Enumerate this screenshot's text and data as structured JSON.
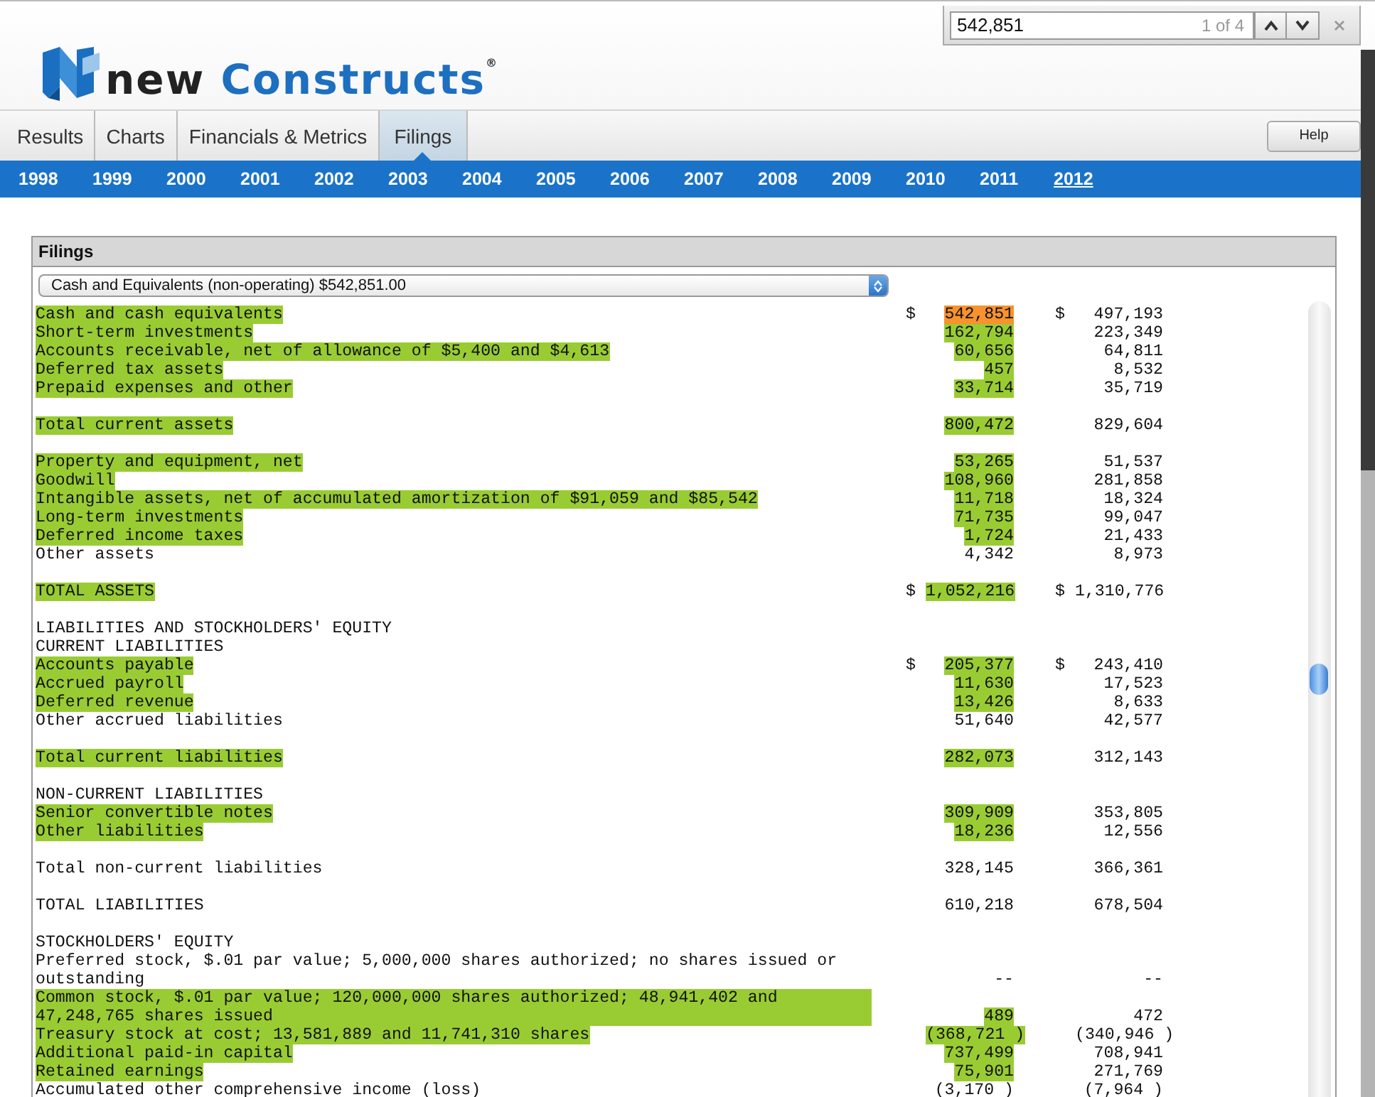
{
  "find_bar": {
    "query": "542,851",
    "count": "1 of 4"
  },
  "logo": {
    "word_1": "new",
    "word_2": "Constructs",
    "mark": "®"
  },
  "tabs": [
    {
      "label": "Results",
      "selected": false
    },
    {
      "label": "Charts",
      "selected": false
    },
    {
      "label": "Financials & Metrics",
      "selected": false
    },
    {
      "label": "Filings",
      "selected": true
    }
  ],
  "help_button": "Help",
  "years": [
    {
      "label": "1998",
      "selected": false
    },
    {
      "label": "1999",
      "selected": false
    },
    {
      "label": "2000",
      "selected": false
    },
    {
      "label": "2001",
      "selected": false
    },
    {
      "label": "2002",
      "selected": false
    },
    {
      "label": "2003",
      "selected": false
    },
    {
      "label": "2004",
      "selected": false
    },
    {
      "label": "2005",
      "selected": false
    },
    {
      "label": "2006",
      "selected": false
    },
    {
      "label": "2007",
      "selected": false
    },
    {
      "label": "2008",
      "selected": false
    },
    {
      "label": "2009",
      "selected": false
    },
    {
      "label": "2010",
      "selected": false
    },
    {
      "label": "2011",
      "selected": false
    },
    {
      "label": "2012",
      "selected": true
    }
  ],
  "panel": {
    "title": "Filings",
    "select_value": "Cash and Equivalents (non-operating) $542,851.00",
    "blocks": [
      {
        "rows": [
          {
            "label": "Cash and cash equivalents",
            "highlighted": true,
            "values": [
              {
                "currency": "$",
                "text": "542,851",
                "matched": true,
                "current": true
              },
              {
                "currency": "$",
                "text": "497,193",
                "matched": false,
                "current": false
              }
            ]
          },
          {
            "label": "Short-term investments",
            "highlighted": true,
            "values": [
              {
                "text": "162,794",
                "matched": true,
                "current": false
              },
              {
                "text": "223,349",
                "matched": false,
                "current": false
              }
            ]
          },
          {
            "label": "Accounts receivable, net of allowance of $5,400 and $4,613",
            "highlighted": true,
            "values": [
              {
                "text": "60,656",
                "matched": true,
                "current": false
              },
              {
                "text": "64,811",
                "matched": false,
                "current": false
              }
            ]
          },
          {
            "label": "Deferred tax assets",
            "highlighted": true,
            "values": [
              {
                "text": "457",
                "matched": true,
                "current": false
              },
              {
                "text": "8,532",
                "matched": false,
                "current": false
              }
            ]
          },
          {
            "label": "Prepaid expenses and other",
            "highlighted": true,
            "values": [
              {
                "text": "33,714",
                "matched": true,
                "current": false
              },
              {
                "text": "35,719",
                "matched": false,
                "current": false
              }
            ]
          }
        ]
      },
      {
        "rows": [
          {
            "label": "Total current assets",
            "highlighted": true,
            "values": [
              {
                "text": "800,472",
                "matched": true,
                "current": false
              },
              {
                "text": "829,604",
                "matched": false,
                "current": false
              }
            ]
          }
        ]
      },
      {
        "rows": [
          {
            "label": "Property and equipment, net",
            "highlighted": true,
            "values": [
              {
                "text": "53,265",
                "matched": true,
                "current": false
              },
              {
                "text": "51,537",
                "matched": false,
                "current": false
              }
            ]
          },
          {
            "label": "Goodwill",
            "highlighted": true,
            "values": [
              {
                "text": "108,960",
                "matched": true,
                "current": false
              },
              {
                "text": "281,858",
                "matched": false,
                "current": false
              }
            ]
          },
          {
            "label": "Intangible assets, net of accumulated amortization of $91,059 and $85,542",
            "highlighted": true,
            "values": [
              {
                "text": "11,718",
                "matched": true,
                "current": false
              },
              {
                "text": "18,324",
                "matched": false,
                "current": false
              }
            ]
          },
          {
            "label": "Long-term investments",
            "highlighted": true,
            "values": [
              {
                "text": "71,735",
                "matched": true,
                "current": false
              },
              {
                "text": "99,047",
                "matched": false,
                "current": false
              }
            ]
          },
          {
            "label": "Deferred income taxes",
            "highlighted": true,
            "values": [
              {
                "text": "1,724",
                "matched": true,
                "current": false
              },
              {
                "text": "21,433",
                "matched": false,
                "current": false
              }
            ]
          },
          {
            "label": "Other assets",
            "highlighted": false,
            "values": [
              {
                "text": "4,342",
                "matched": false,
                "current": false
              },
              {
                "text": "8,973",
                "matched": false,
                "current": false
              }
            ]
          }
        ]
      },
      {
        "rows": [
          {
            "label": "TOTAL ASSETS",
            "highlighted": true,
            "values": [
              {
                "currency": "$",
                "text": "1,052,216",
                "matched": true,
                "current": false
              },
              {
                "currency": "$",
                "text": "1,310,776",
                "matched": false,
                "current": false
              }
            ]
          }
        ]
      },
      {
        "rows": [
          {
            "label": "LIABILITIES AND STOCKHOLDERS' EQUITY",
            "highlighted": false
          },
          {
            "label": "CURRENT LIABILITIES",
            "highlighted": false
          },
          {
            "label": "Accounts payable",
            "highlighted": true,
            "values": [
              {
                "currency": "$",
                "text": "205,377",
                "matched": true,
                "current": false
              },
              {
                "currency": "$",
                "text": "243,410",
                "matched": false,
                "current": false
              }
            ]
          },
          {
            "label": "Accrued payroll",
            "highlighted": true,
            "values": [
              {
                "text": "11,630",
                "matched": true,
                "current": false
              },
              {
                "text": "17,523",
                "matched": false,
                "current": false
              }
            ]
          },
          {
            "label": "Deferred revenue",
            "highlighted": true,
            "values": [
              {
                "text": "13,426",
                "matched": true,
                "current": false
              },
              {
                "text": "8,633",
                "matched": false,
                "current": false
              }
            ]
          },
          {
            "label": "Other accrued liabilities",
            "highlighted": false,
            "values": [
              {
                "text": "51,640",
                "matched": false,
                "current": false
              },
              {
                "text": "42,577",
                "matched": false,
                "current": false
              }
            ]
          }
        ]
      },
      {
        "rows": [
          {
            "label": "Total current liabilities",
            "highlighted": true,
            "values": [
              {
                "text": "282,073",
                "matched": true,
                "current": false
              },
              {
                "text": "312,143",
                "matched": false,
                "current": false
              }
            ]
          }
        ]
      },
      {
        "rows": [
          {
            "label": "NON-CURRENT LIABILITIES",
            "highlighted": false
          },
          {
            "label": "Senior convertible notes",
            "highlighted": true,
            "values": [
              {
                "text": "309,909",
                "matched": true,
                "current": false
              },
              {
                "text": "353,805",
                "matched": false,
                "current": false
              }
            ]
          },
          {
            "label": "Other liabilities",
            "highlighted": true,
            "values": [
              {
                "text": "18,236",
                "matched": true,
                "current": false
              },
              {
                "text": "12,556",
                "matched": false,
                "current": false
              }
            ]
          }
        ]
      },
      {
        "rows": [
          {
            "label": "Total non-current liabilities",
            "highlighted": false,
            "values": [
              {
                "text": "328,145",
                "matched": false,
                "current": false
              },
              {
                "text": "366,361",
                "matched": false,
                "current": false
              }
            ]
          }
        ]
      },
      {
        "rows": [
          {
            "label": "TOTAL LIABILITIES",
            "highlighted": false,
            "values": [
              {
                "text": "610,218",
                "matched": false,
                "current": false
              },
              {
                "text": "678,504",
                "matched": false,
                "current": false
              }
            ]
          }
        ]
      },
      {
        "rows": [
          {
            "label": "STOCKHOLDERS' EQUITY",
            "highlighted": false
          },
          {
            "label": "Preferred stock, $.01 par value; 5,000,000 shares authorized; no shares issued or outstanding",
            "highlighted": false,
            "values": [
              {
                "text": "--",
                "matched": false,
                "current": false
              },
              {
                "text": "--",
                "matched": false,
                "current": false
              }
            ]
          },
          {
            "label": "Common stock, $.01 par value; 120,000,000 shares authorized; 48,941,402 and 47,248,765 shares issued",
            "highlighted": true,
            "values": [
              {
                "text": "489",
                "matched": true,
                "current": false
              },
              {
                "text": "472",
                "matched": false,
                "current": false
              }
            ]
          },
          {
            "label": "Treasury stock at cost; 13,581,889 and 11,741,310 shares",
            "highlighted": true,
            "values": [
              {
                "text": "(368,721 )",
                "matched": true,
                "current": false
              },
              {
                "text": "(340,946 )",
                "matched": false,
                "current": false
              }
            ]
          },
          {
            "label": "Additional paid-in capital",
            "highlighted": true,
            "values": [
              {
                "text": "737,499",
                "matched": true,
                "current": false
              },
              {
                "text": "708,941",
                "matched": false,
                "current": false
              }
            ]
          },
          {
            "label": "Retained earnings",
            "highlighted": true,
            "values": [
              {
                "text": "75,901",
                "matched": true,
                "current": false
              },
              {
                "text": "271,769",
                "matched": false,
                "current": false
              }
            ]
          },
          {
            "label": "Accumulated other comprehensive income (loss)",
            "highlighted": false,
            "values": [
              {
                "text": "(3,170 )",
                "matched": false,
                "current": false
              },
              {
                "text": "(7,964 )",
                "matched": false,
                "current": false
              }
            ]
          }
        ]
      }
    ]
  }
}
